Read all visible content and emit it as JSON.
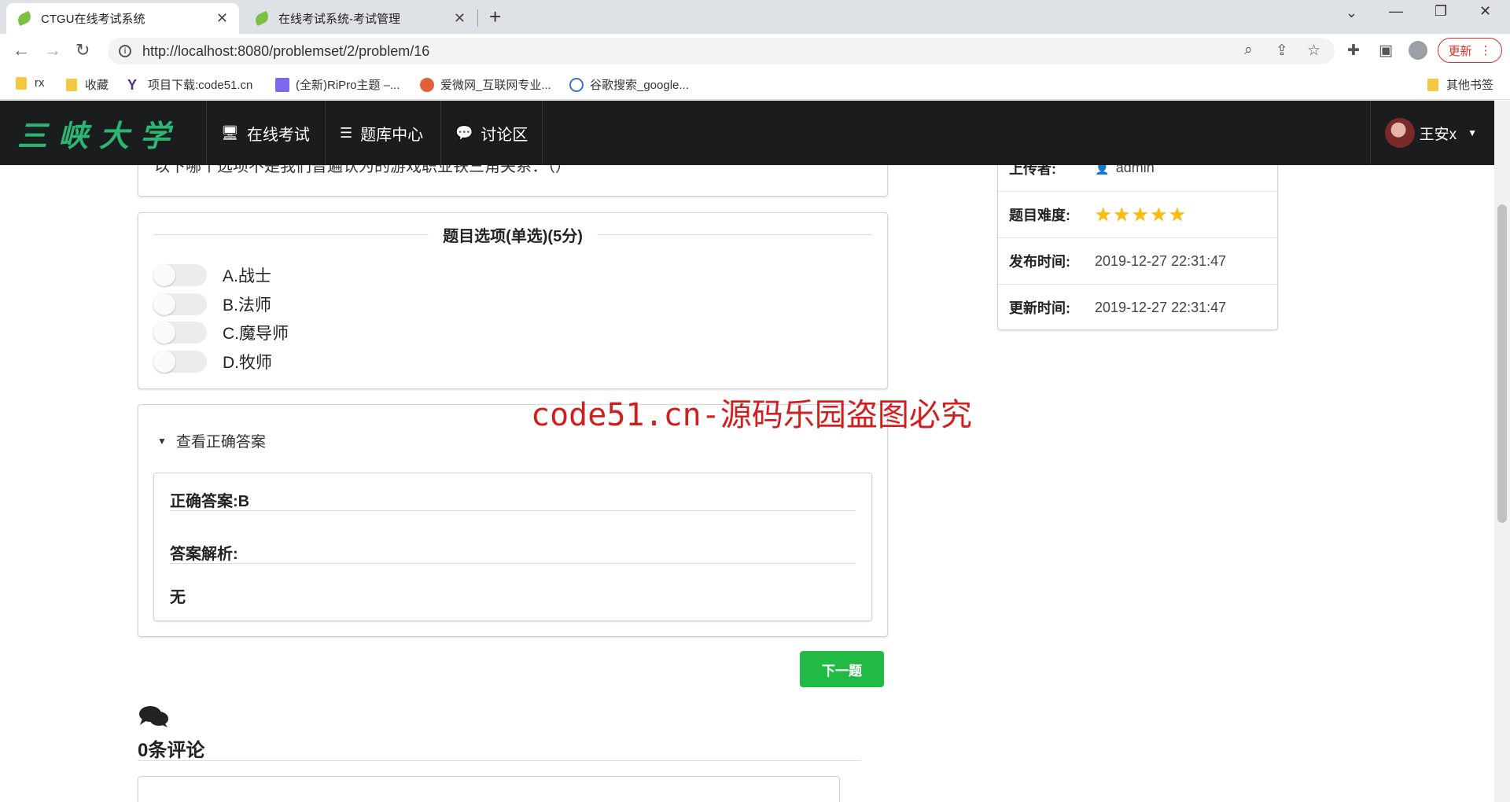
{
  "browser": {
    "tabs": [
      {
        "label": "CTGU在线考试系统",
        "active": true
      },
      {
        "label": "在线考试系统-考试管理",
        "active": false
      }
    ],
    "url": "http://localhost:8080/problemset/2/problem/16",
    "update_label": "更新",
    "bookmarks": [
      "rx",
      "收藏",
      "项目下载:code51.cn",
      "(全新)RiPro主题 –...",
      "爱微网_互联网专业...",
      "谷歌搜索_google..."
    ],
    "other_bookmarks": "其他书签"
  },
  "nav": {
    "logo": "三峡大学",
    "items": [
      {
        "label": "在线考试",
        "icon": "desktop-icon"
      },
      {
        "label": "题库中心",
        "icon": "list-icon"
      },
      {
        "label": "讨论区",
        "icon": "comment-icon"
      }
    ],
    "user_name": "王安x"
  },
  "question": {
    "text": "以下哪个选项不是我们普遍认为的游戏职业铁三角关系：（）",
    "options_title": "题目选项(单选)(5分)",
    "options": [
      "A.战士",
      "B.法师",
      "C.魔导师",
      "D.牧师"
    ]
  },
  "answer": {
    "toggle_label": "查看正确答案",
    "correct_label": "正确答案:B",
    "analysis_label": "答案解析:",
    "analysis_text": "无"
  },
  "next_label": "下一题",
  "comments": {
    "title": "0条评论"
  },
  "info": {
    "uploader_key": "上传者:",
    "uploader_value": "admin",
    "difficulty_key": "题目难度:",
    "difficulty_stars": 5,
    "publish_key": "发布时间:",
    "publish_value": "2019-12-27 22:31:47",
    "update_key": "更新时间:",
    "update_value": "2019-12-27 22:31:47"
  },
  "watermark": "code51.cn-源码乐园盗图必究",
  "colors": {
    "accent_green": "#21ba45",
    "navbar_bg": "#1b1c1d",
    "star": "#fbbd08",
    "watermark": "#d01f1f"
  }
}
